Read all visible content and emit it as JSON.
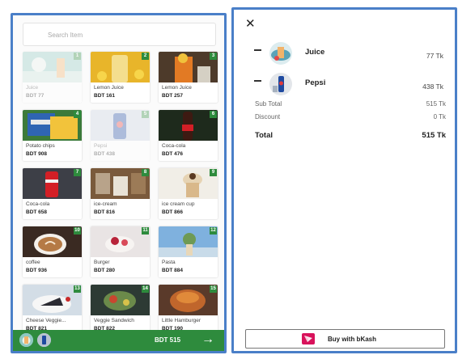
{
  "search": {
    "placeholder": "Search Item"
  },
  "products": [
    {
      "badge": "1",
      "name": "Juice",
      "price": "BDT 77",
      "image": "juice-image",
      "faded": true
    },
    {
      "badge": "2",
      "name": "Lemon Juice",
      "price": "BDT 161",
      "image": "lemon-juice-image",
      "faded": false
    },
    {
      "badge": "3",
      "name": "Lemon Juice",
      "price": "BDT 257",
      "image": "lemon-juice-glass-image",
      "faded": false
    },
    {
      "badge": "4",
      "name": "Potato chips",
      "price": "BDT 908",
      "image": "potato-chips-image",
      "faded": false
    },
    {
      "badge": "5",
      "name": "Pepsi",
      "price": "BDT 438",
      "image": "pepsi-image",
      "faded": true
    },
    {
      "badge": "6",
      "name": "Coca-cola",
      "price": "BDT 476",
      "image": "coca-cola-bottle-image",
      "faded": false
    },
    {
      "badge": "7",
      "name": "Coca-cola",
      "price": "BDT 658",
      "image": "coca-cola-can-image",
      "faded": false
    },
    {
      "badge": "8",
      "name": "ice-cream",
      "price": "BDT 816",
      "image": "ice-cream-image",
      "faded": false
    },
    {
      "badge": "9",
      "name": "ice cream cup",
      "price": "BDT 866",
      "image": "ice-cream-cup-image",
      "faded": false
    },
    {
      "badge": "10",
      "name": "coffee",
      "price": "BDT 936",
      "image": "coffee-image",
      "faded": false
    },
    {
      "badge": "11",
      "name": "Burger",
      "price": "BDT 280",
      "image": "burger-image",
      "faded": false
    },
    {
      "badge": "12",
      "name": "Pasta",
      "price": "BDT 884",
      "image": "pasta-image",
      "faded": false
    },
    {
      "badge": "13",
      "name": "Cheese Veggie...",
      "price": "BDT 821",
      "image": "cheese-veggie-image",
      "faded": false
    },
    {
      "badge": "14",
      "name": "Veggie Sandwich",
      "price": "BDT 822",
      "image": "veggie-sandwich-image",
      "faded": false
    },
    {
      "badge": "15",
      "name": "Little Hamburger",
      "price": "BDT 190",
      "image": "little-hamburger-image",
      "faded": false
    }
  ],
  "cart_bar": {
    "total": "BDT 515",
    "arrow": "→"
  },
  "cart": {
    "close_glyph": "✕",
    "items": [
      {
        "name": "Juice",
        "price": "77 Tk",
        "image": "juice-thumb"
      },
      {
        "name": "Pepsi",
        "price": "438 Tk",
        "image": "pepsi-thumb"
      }
    ],
    "subtotal_label": "Sub Total",
    "subtotal_value": "515 Tk",
    "discount_label": "Discount",
    "discount_value": "0 Tk",
    "total_label": "Total",
    "total_value": "515 Tk",
    "pay_button": "Buy with bKash"
  },
  "colors": {
    "accent_green": "#2e8b3d",
    "panel_border": "#4a7fc8",
    "bkash_pink": "#d8125b"
  }
}
